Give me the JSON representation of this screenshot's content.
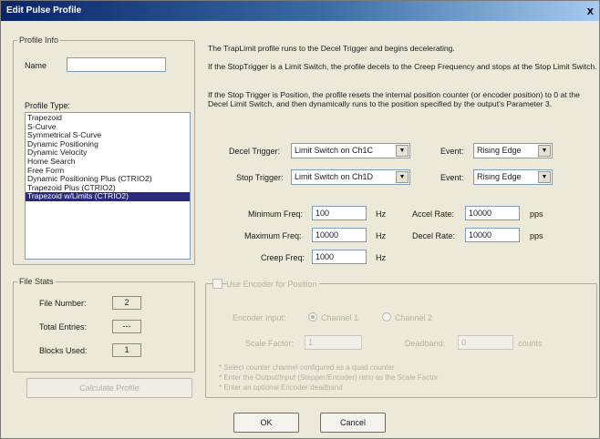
{
  "window": {
    "title": "Edit Pulse Profile",
    "close_glyph": "x"
  },
  "profile_info": {
    "legend": "Profile Info",
    "name_label": "Name",
    "name_value": "",
    "type_label": "Profile Type:",
    "types": [
      "Trapezoid",
      "S-Curve",
      "Symmetrical S-Curve",
      "Dynamic Positioning",
      "Dynamic Velocity",
      "Home Search",
      "Free Form",
      "Dynamic Positioning Plus (CTRIO2)",
      "Trapezoid Plus (CTRIO2)",
      "Trapezoid w/Limits (CTRIO2)"
    ],
    "selected_index": 9
  },
  "file_stats": {
    "legend": "File Stats",
    "file_number_label": "File Number:",
    "file_number": "2",
    "total_entries_label": "Total Entries:",
    "total_entries": "---",
    "blocks_used_label": "Blocks Used:",
    "blocks_used": "1"
  },
  "calculate_button": "Calculate Profile",
  "description": {
    "line1": "The TrapLimit profile runs to the Decel Trigger and begins decelerating.",
    "line2": "If the StopTrigger is a Limit Switch, the profile decels to the Creep Frequency and stops at the Stop Limit Switch.",
    "line3": "If the Stop Trigger is Position, the profile resets the internal position counter (or encoder position) to 0 at the Decel Limit Switch, and then dynamically runs to the position specified by the output's Parameter 3."
  },
  "triggers": {
    "decel_label": "Decel Trigger:",
    "decel_value": "Limit Switch on Ch1C",
    "decel_event_label": "Event:",
    "decel_event": "Rising Edge",
    "stop_label": "Stop Trigger:",
    "stop_value": "Limit Switch on Ch1D",
    "stop_event_label": "Event:",
    "stop_event": "Rising Edge"
  },
  "frequencies": {
    "min_label": "Minimum Freq:",
    "min_value": "100",
    "max_label": "Maximum Freq:",
    "max_value": "10000",
    "creep_label": "Creep Freq:",
    "creep_value": "1000",
    "unit_hz": "Hz",
    "accel_label": "Accel Rate:",
    "accel_value": "10000",
    "decel_label": "Decel Rate:",
    "decel_value": "10000",
    "unit_pps": "pps"
  },
  "encoder": {
    "checkbox_label": "Use Encoder for Position",
    "checked": false,
    "input_label": "Encoder Input:",
    "channel1": "Channel 1",
    "channel2": "Channel 2",
    "selected_channel": 1,
    "scale_label": "Scale Factor:",
    "scale_value": "1",
    "deadband_label": "Deadband:",
    "deadband_value": "0",
    "deadband_unit": "counts",
    "note1": "* Select counter channel configured as a quad counter",
    "note2": "* Enter the Output/Input (Stepper/Encoder) ratio as the Scale Factor",
    "note3": "* Enter an optional Encoder deadband"
  },
  "buttons": {
    "ok": "OK",
    "cancel": "Cancel"
  },
  "colors": {
    "titlebar_start": "#0a246a",
    "selection": "#2a2a7a",
    "dialog_bg": "#ece9d8"
  }
}
